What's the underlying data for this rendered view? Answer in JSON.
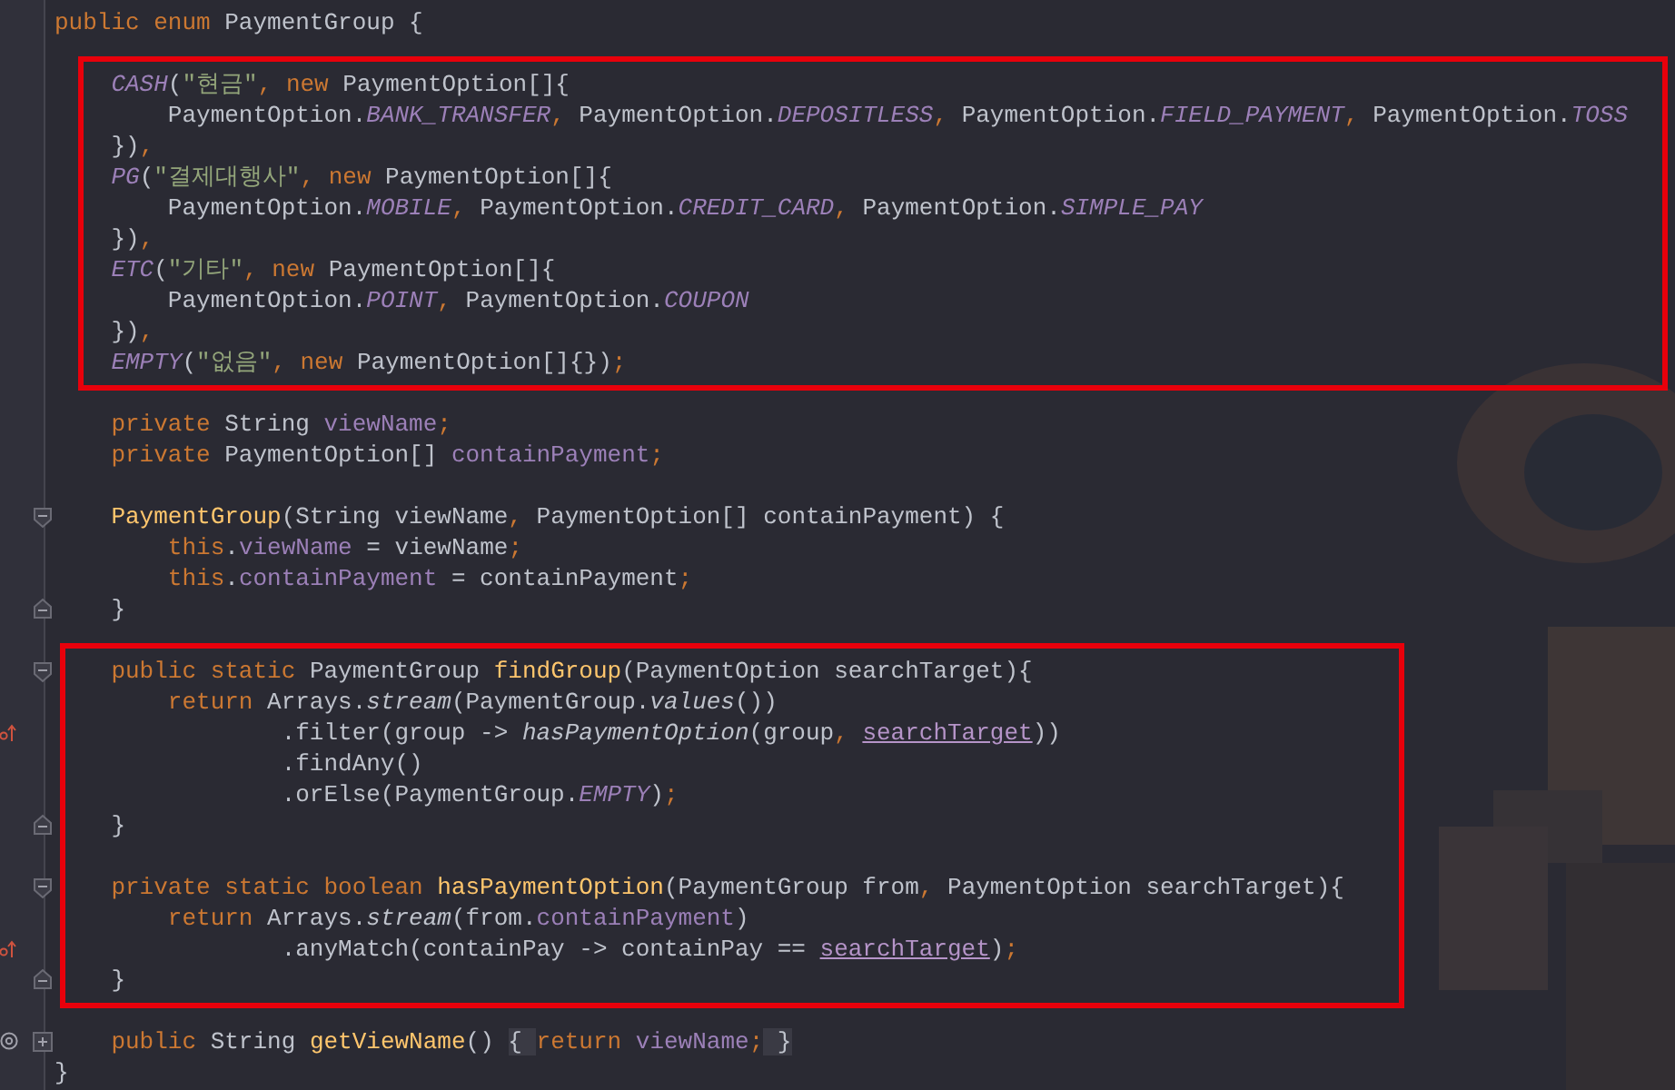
{
  "blocks": [
    {
      "highlighted": false,
      "lines": [
        {
          "kind": "code",
          "tokens": [
            {
              "kind": "keyword",
              "text": "public enum "
            },
            {
              "kind": "plain",
              "text": "PaymentGroup {"
            }
          ]
        },
        {
          "kind": "blank"
        }
      ]
    },
    {
      "highlighted": true,
      "lines": [
        {
          "kind": "code",
          "tokens": [
            {
              "kind": "constant",
              "text": "    CASH"
            },
            {
              "kind": "plain",
              "text": "("
            },
            {
              "kind": "string",
              "text": "\"현금\""
            },
            {
              "kind": "keyword",
              "text": ", new"
            },
            {
              "kind": "plain",
              "text": " PaymentOption[]{"
            }
          ]
        },
        {
          "kind": "code",
          "tokens": [
            {
              "kind": "plain",
              "text": "        PaymentOption."
            },
            {
              "kind": "constant",
              "text": "BANK_TRANSFER"
            },
            {
              "kind": "keyword",
              "text": ", "
            },
            {
              "kind": "plain",
              "text": "PaymentOption."
            },
            {
              "kind": "constant",
              "text": "DEPOSITLESS"
            },
            {
              "kind": "keyword",
              "text": ", "
            },
            {
              "kind": "plain",
              "text": "PaymentOption."
            },
            {
              "kind": "constant",
              "text": "FIELD_PAYMENT"
            },
            {
              "kind": "keyword",
              "text": ", "
            },
            {
              "kind": "plain",
              "text": "PaymentOption."
            },
            {
              "kind": "constant",
              "text": "TOSS"
            }
          ]
        },
        {
          "kind": "code",
          "tokens": [
            {
              "kind": "plain",
              "text": "    })"
            },
            {
              "kind": "keyword",
              "text": ","
            }
          ]
        },
        {
          "kind": "code",
          "tokens": [
            {
              "kind": "constant",
              "text": "    PG"
            },
            {
              "kind": "plain",
              "text": "("
            },
            {
              "kind": "string",
              "text": "\"결제대행사\""
            },
            {
              "kind": "keyword",
              "text": ", new"
            },
            {
              "kind": "plain",
              "text": " PaymentOption[]{"
            }
          ]
        },
        {
          "kind": "code",
          "tokens": [
            {
              "kind": "plain",
              "text": "        PaymentOption."
            },
            {
              "kind": "constant",
              "text": "MOBILE"
            },
            {
              "kind": "keyword",
              "text": ", "
            },
            {
              "kind": "plain",
              "text": "PaymentOption."
            },
            {
              "kind": "constant",
              "text": "CREDIT_CARD"
            },
            {
              "kind": "keyword",
              "text": ", "
            },
            {
              "kind": "plain",
              "text": "PaymentOption."
            },
            {
              "kind": "constant",
              "text": "SIMPLE_PAY"
            }
          ]
        },
        {
          "kind": "code",
          "tokens": [
            {
              "kind": "plain",
              "text": "    })"
            },
            {
              "kind": "keyword",
              "text": ","
            }
          ]
        },
        {
          "kind": "code",
          "tokens": [
            {
              "kind": "constant",
              "text": "    ETC"
            },
            {
              "kind": "plain",
              "text": "("
            },
            {
              "kind": "string",
              "text": "\"기타\""
            },
            {
              "kind": "keyword",
              "text": ", new"
            },
            {
              "kind": "plain",
              "text": " PaymentOption[]{"
            }
          ]
        },
        {
          "kind": "code",
          "tokens": [
            {
              "kind": "plain",
              "text": "        PaymentOption."
            },
            {
              "kind": "constant",
              "text": "POINT"
            },
            {
              "kind": "keyword",
              "text": ", "
            },
            {
              "kind": "plain",
              "text": "PaymentOption."
            },
            {
              "kind": "constant",
              "text": "COUPON"
            }
          ]
        },
        {
          "kind": "code",
          "tokens": [
            {
              "kind": "plain",
              "text": "    })"
            },
            {
              "kind": "keyword",
              "text": ","
            }
          ]
        },
        {
          "kind": "code",
          "tokens": [
            {
              "kind": "constant",
              "text": "    EMPTY"
            },
            {
              "kind": "plain",
              "text": "("
            },
            {
              "kind": "string",
              "text": "\"없음\""
            },
            {
              "kind": "keyword",
              "text": ", new"
            },
            {
              "kind": "plain",
              "text": " PaymentOption[]{})"
            },
            {
              "kind": "keyword",
              "text": ";"
            }
          ]
        }
      ]
    },
    {
      "highlighted": false,
      "lines": [
        {
          "kind": "blank"
        },
        {
          "kind": "code",
          "tokens": [
            {
              "kind": "keyword",
              "text": "    private "
            },
            {
              "kind": "plain",
              "text": "String "
            },
            {
              "kind": "field",
              "text": "viewName"
            },
            {
              "kind": "keyword",
              "text": ";"
            }
          ]
        },
        {
          "kind": "code",
          "tokens": [
            {
              "kind": "keyword",
              "text": "    private "
            },
            {
              "kind": "plain",
              "text": "PaymentOption[] "
            },
            {
              "kind": "field",
              "text": "containPayment"
            },
            {
              "kind": "keyword",
              "text": ";"
            }
          ]
        },
        {
          "kind": "blank"
        },
        {
          "kind": "code",
          "gutter": [
            {
              "kind": "fold-start"
            }
          ],
          "tokens": [
            {
              "kind": "method",
              "text": "    PaymentGroup"
            },
            {
              "kind": "plain",
              "text": "(String viewName"
            },
            {
              "kind": "keyword",
              "text": ", "
            },
            {
              "kind": "plain",
              "text": "PaymentOption[] containPayment) {"
            }
          ]
        },
        {
          "kind": "code",
          "tokens": [
            {
              "kind": "keyword",
              "text": "        this"
            },
            {
              "kind": "plain",
              "text": "."
            },
            {
              "kind": "field",
              "text": "viewName"
            },
            {
              "kind": "plain",
              "text": " = viewName"
            },
            {
              "kind": "keyword",
              "text": ";"
            }
          ]
        },
        {
          "kind": "code",
          "tokens": [
            {
              "kind": "keyword",
              "text": "        this"
            },
            {
              "kind": "plain",
              "text": "."
            },
            {
              "kind": "field",
              "text": "containPayment"
            },
            {
              "kind": "plain",
              "text": " = containPayment"
            },
            {
              "kind": "keyword",
              "text": ";"
            }
          ]
        },
        {
          "kind": "code",
          "gutter": [
            {
              "kind": "fold-end"
            }
          ],
          "tokens": [
            {
              "kind": "plain",
              "text": "    }"
            }
          ]
        },
        {
          "kind": "blank"
        }
      ]
    },
    {
      "highlighted": true,
      "lines": [
        {
          "kind": "code",
          "gutter": [
            {
              "kind": "fold-start"
            }
          ],
          "tokens": [
            {
              "kind": "keyword",
              "text": "    public static "
            },
            {
              "kind": "plain",
              "text": "PaymentGroup "
            },
            {
              "kind": "method",
              "text": "findGroup"
            },
            {
              "kind": "plain",
              "text": "(PaymentOption searchTarget){"
            }
          ]
        },
        {
          "kind": "code",
          "tokens": [
            {
              "kind": "keyword",
              "text": "        return "
            },
            {
              "kind": "plain",
              "text": "Arrays."
            },
            {
              "kind": "static",
              "text": "stream"
            },
            {
              "kind": "plain",
              "text": "(PaymentGroup."
            },
            {
              "kind": "static",
              "text": "values"
            },
            {
              "kind": "plain",
              "text": "())"
            }
          ]
        },
        {
          "kind": "code",
          "gutter": [
            {
              "kind": "override"
            }
          ],
          "tokens": [
            {
              "kind": "plain",
              "text": "                .filter(group -> "
            },
            {
              "kind": "static",
              "text": "hasPaymentOption"
            },
            {
              "kind": "plain",
              "text": "(group"
            },
            {
              "kind": "keyword",
              "text": ", "
            },
            {
              "kind": "param",
              "text": "searchTarget"
            },
            {
              "kind": "plain",
              "text": "))"
            }
          ]
        },
        {
          "kind": "code",
          "tokens": [
            {
              "kind": "plain",
              "text": "                .findAny()"
            }
          ]
        },
        {
          "kind": "code",
          "tokens": [
            {
              "kind": "plain",
              "text": "                .orElse(PaymentGroup."
            },
            {
              "kind": "constant",
              "text": "EMPTY"
            },
            {
              "kind": "plain",
              "text": ")"
            },
            {
              "kind": "keyword",
              "text": ";"
            }
          ]
        },
        {
          "kind": "code",
          "gutter": [
            {
              "kind": "fold-end"
            }
          ],
          "tokens": [
            {
              "kind": "plain",
              "text": "    }"
            }
          ]
        },
        {
          "kind": "blank"
        },
        {
          "kind": "code",
          "gutter": [
            {
              "kind": "fold-start"
            }
          ],
          "tokens": [
            {
              "kind": "keyword",
              "text": "    private static boolean "
            },
            {
              "kind": "method",
              "text": "hasPaymentOption"
            },
            {
              "kind": "plain",
              "text": "(PaymentGroup from"
            },
            {
              "kind": "keyword",
              "text": ", "
            },
            {
              "kind": "plain",
              "text": "PaymentOption searchTarget){"
            }
          ]
        },
        {
          "kind": "code",
          "tokens": [
            {
              "kind": "keyword",
              "text": "        return "
            },
            {
              "kind": "plain",
              "text": "Arrays."
            },
            {
              "kind": "static",
              "text": "stream"
            },
            {
              "kind": "plain",
              "text": "(from."
            },
            {
              "kind": "field",
              "text": "containPayment"
            },
            {
              "kind": "plain",
              "text": ")"
            }
          ]
        },
        {
          "kind": "code",
          "gutter": [
            {
              "kind": "override"
            }
          ],
          "tokens": [
            {
              "kind": "plain",
              "text": "                .anyMatch(containPay -> containPay == "
            },
            {
              "kind": "param",
              "text": "searchTarget"
            },
            {
              "kind": "plain",
              "text": ")"
            },
            {
              "kind": "keyword",
              "text": ";"
            }
          ]
        },
        {
          "kind": "code",
          "gutter": [
            {
              "kind": "fold-end"
            }
          ],
          "tokens": [
            {
              "kind": "plain",
              "text": "    }"
            }
          ]
        }
      ]
    },
    {
      "highlighted": false,
      "lines": [
        {
          "kind": "blank"
        },
        {
          "kind": "code",
          "gutter": [
            {
              "kind": "at"
            },
            {
              "kind": "expand"
            }
          ],
          "tokens": [
            {
              "kind": "keyword",
              "text": "    public "
            },
            {
              "kind": "plain",
              "text": "String "
            },
            {
              "kind": "method",
              "text": "getViewName"
            },
            {
              "kind": "plain",
              "text": "() "
            },
            {
              "kind": "folded",
              "text": "{ "
            },
            {
              "kind": "keyword",
              "text": "return "
            },
            {
              "kind": "field",
              "text": "viewName"
            },
            {
              "kind": "keyword",
              "text": ";"
            },
            {
              "kind": "folded",
              "text": " }"
            }
          ]
        },
        {
          "kind": "code",
          "tokens": [
            {
              "kind": "plain",
              "text": "}"
            }
          ]
        }
      ]
    }
  ]
}
